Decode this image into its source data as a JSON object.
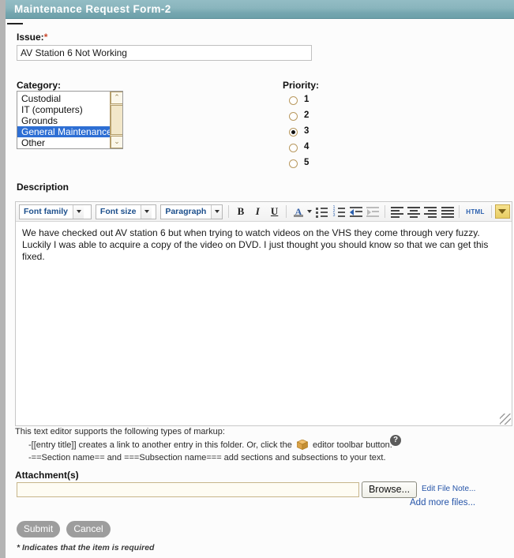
{
  "window": {
    "title": "Maintenance Request Form-2"
  },
  "form": {
    "issue": {
      "label": "Issue:",
      "required_marker": "*",
      "value": "AV Station 6 Not Working",
      "placeholder": ""
    },
    "category": {
      "label": "Category:",
      "options": [
        "Custodial",
        "IT (computers)",
        "Grounds",
        "General Maintenance",
        "Other"
      ],
      "selected": "General Maintenance",
      "scroll_up_glyph": "⌃",
      "scroll_down_glyph": "⌄"
    },
    "priority": {
      "label": "Priority:",
      "options": [
        "1",
        "2",
        "3",
        "4",
        "5"
      ],
      "selected": "3"
    },
    "description": {
      "label": "Description",
      "value": "We have checked out AV station 6 but when trying to watch videos on the VHS they come through very fuzzy. Luckily I was able to acquire a copy of the video on DVD. I just thought you should know so that we can get this fixed."
    },
    "attachments": {
      "label": "Attachment(s)",
      "value": "",
      "placeholder": "",
      "browse_label": "Browse...",
      "edit_file_note_label": "Edit File Note...",
      "add_more_files_label": "Add more files..."
    }
  },
  "editor_toolbar": {
    "font_family": "Font family",
    "font_size": "Font size",
    "paragraph": "Paragraph",
    "bold": "B",
    "italic": "I",
    "underline": "U",
    "html": "HTML",
    "buttons": [
      "fontselect",
      "fontsizeselect",
      "formatselect",
      "bold",
      "italic",
      "underline",
      "forecolor",
      "bullist",
      "numlist",
      "indent",
      "outdent",
      "justifyleft",
      "justifycenter",
      "justifyright",
      "justifyfull",
      "code",
      "moreitems"
    ]
  },
  "help": {
    "intro": "This text editor supports the following types of markup:",
    "line1_before": "-[[entry title]] creates a link to another entry in this folder. Or, click the",
    "line1_after": "editor toolbar button.",
    "line2": "-==Section name== and ===Subsection name=== add sections and subsections to your text.",
    "help_glyph": "?"
  },
  "footer": {
    "submit": "Submit",
    "cancel": "Cancel",
    "required_note": "* Indicates that the item is required"
  },
  "colors": {
    "titlebar": "#86b2ba",
    "selection_blue": "#2e6fd4",
    "link_blue": "#2554a8",
    "required_red": "#c9472b",
    "radio_border": "#b9995f",
    "button_gray": "#9d9d9d",
    "attach_field_bg": "#fefcf3",
    "toolbar_label_blue": "#1c4f8c"
  }
}
